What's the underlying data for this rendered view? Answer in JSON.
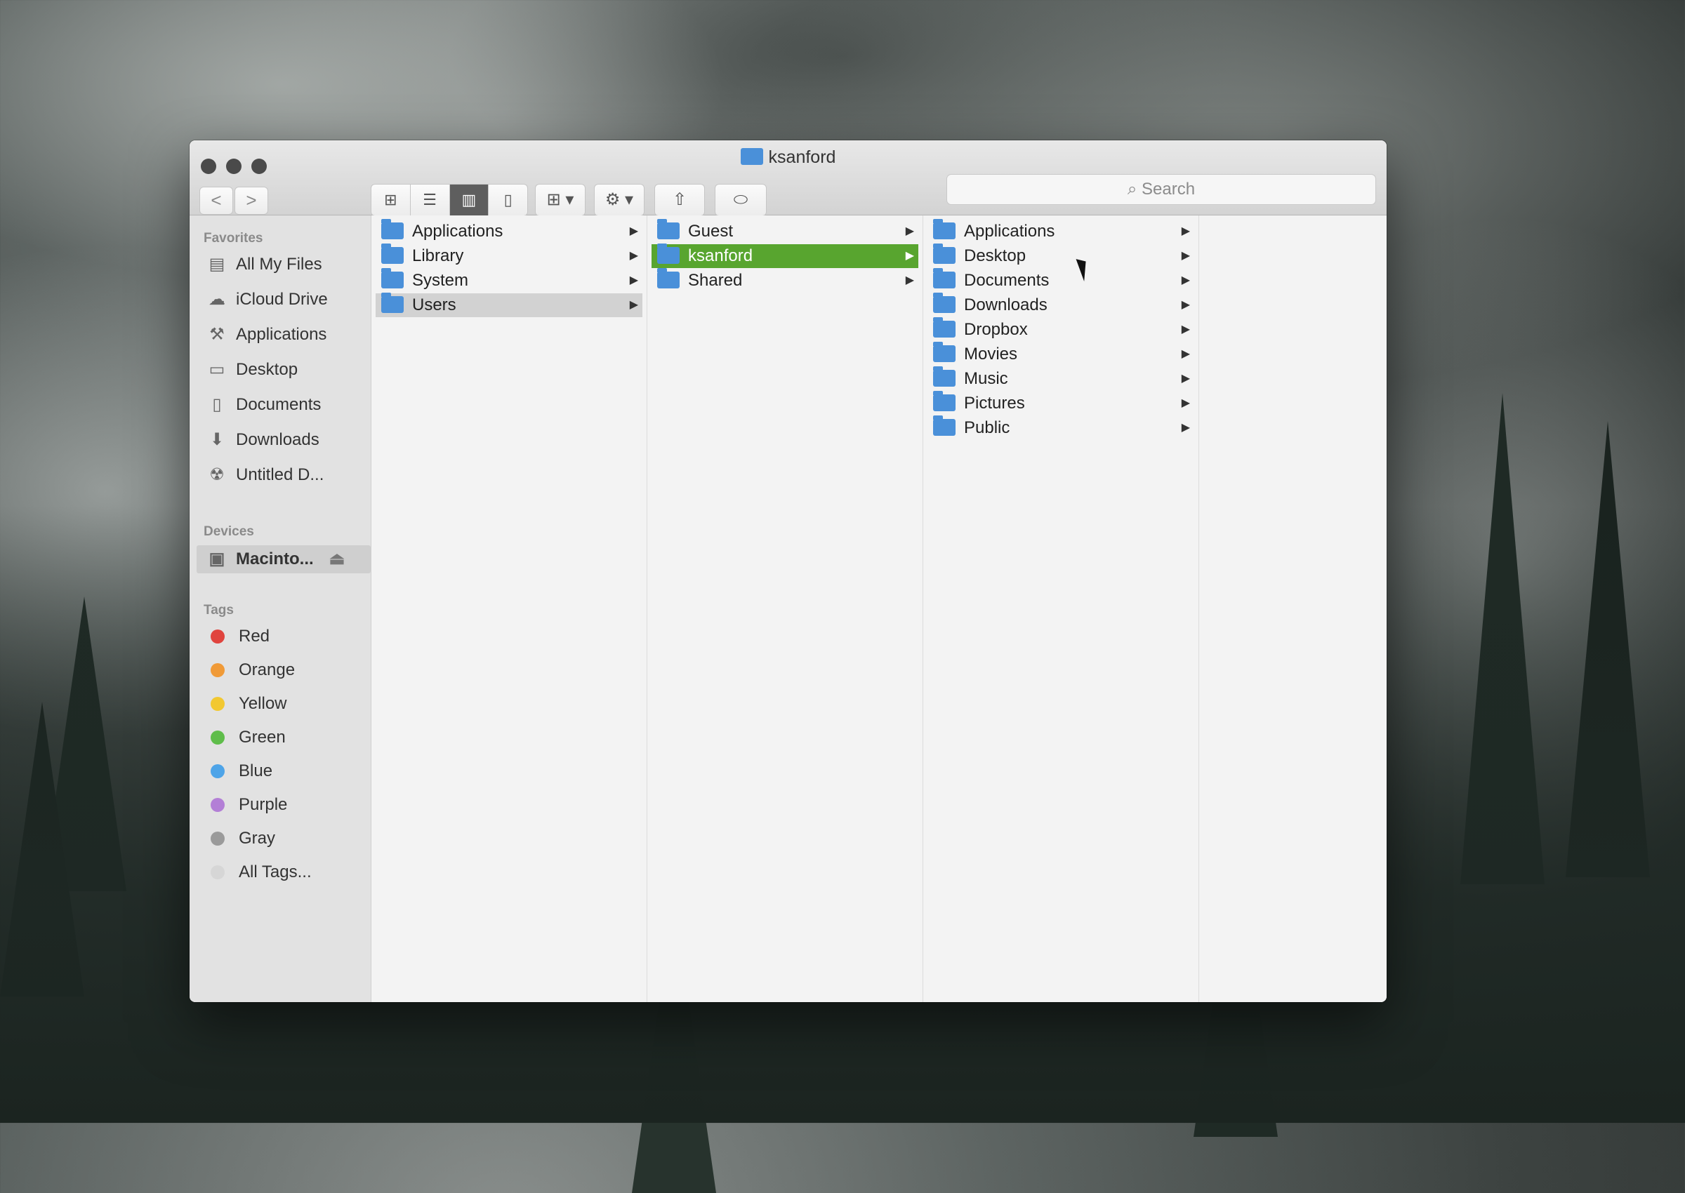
{
  "window": {
    "title": "ksanford"
  },
  "toolbar": {
    "back": "<",
    "forward": ">",
    "search_placeholder": "Search"
  },
  "sidebar": {
    "favorites_label": "Favorites",
    "favorites": [
      {
        "label": "All My Files",
        "icon": "all-files-icon"
      },
      {
        "label": "iCloud Drive",
        "icon": "cloud-icon"
      },
      {
        "label": "Applications",
        "icon": "applications-icon"
      },
      {
        "label": "Desktop",
        "icon": "desktop-icon"
      },
      {
        "label": "Documents",
        "icon": "documents-icon"
      },
      {
        "label": "Downloads",
        "icon": "downloads-icon"
      },
      {
        "label": "Untitled D...",
        "icon": "disk-icon"
      }
    ],
    "devices_label": "Devices",
    "devices": [
      {
        "label": "Macinto...",
        "icon": "hard-drive-icon"
      }
    ],
    "tags_label": "Tags",
    "tags": [
      {
        "label": "Red",
        "color": "#e0443e"
      },
      {
        "label": "Orange",
        "color": "#f09a37"
      },
      {
        "label": "Yellow",
        "color": "#f2c831"
      },
      {
        "label": "Green",
        "color": "#5fbd4a"
      },
      {
        "label": "Blue",
        "color": "#4ea4e8"
      },
      {
        "label": "Purple",
        "color": "#b37fd6"
      },
      {
        "label": "Gray",
        "color": "#9a9a9a"
      },
      {
        "label": "All Tags...",
        "color": "#d6d6d6"
      }
    ]
  },
  "columns": [
    {
      "items": [
        {
          "label": "Applications",
          "state": ""
        },
        {
          "label": "Library",
          "state": ""
        },
        {
          "label": "System",
          "state": ""
        },
        {
          "label": "Users",
          "state": "gray"
        }
      ]
    },
    {
      "items": [
        {
          "label": "Guest",
          "state": ""
        },
        {
          "label": "ksanford",
          "state": "green"
        },
        {
          "label": "Shared",
          "state": ""
        }
      ]
    },
    {
      "items": [
        {
          "label": "Applications",
          "state": ""
        },
        {
          "label": "Desktop",
          "state": ""
        },
        {
          "label": "Documents",
          "state": ""
        },
        {
          "label": "Downloads",
          "state": ""
        },
        {
          "label": "Dropbox",
          "state": ""
        },
        {
          "label": "Movies",
          "state": ""
        },
        {
          "label": "Music",
          "state": ""
        },
        {
          "label": "Pictures",
          "state": ""
        },
        {
          "label": "Public",
          "state": ""
        }
      ]
    }
  ]
}
